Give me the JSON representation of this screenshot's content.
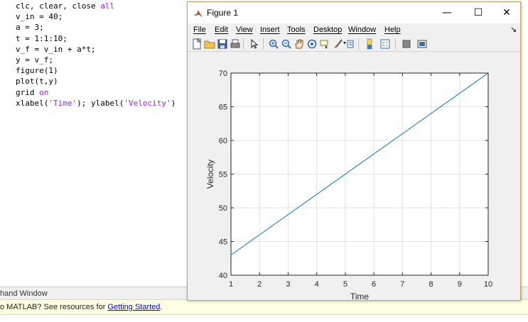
{
  "editor": {
    "lines": [
      {
        "parts": [
          {
            "t": "clc, clear, close ",
            "c": "plain"
          },
          {
            "t": "all",
            "c": "kw"
          }
        ]
      },
      {
        "parts": [
          {
            "t": "v_in = 40;",
            "c": "plain"
          }
        ]
      },
      {
        "parts": [
          {
            "t": "a = 3;",
            "c": "plain"
          }
        ]
      },
      {
        "parts": [
          {
            "t": "t = 1:1:10;",
            "c": "plain"
          }
        ]
      },
      {
        "parts": [
          {
            "t": "v_f = v_in + a*t;",
            "c": "plain"
          }
        ]
      },
      {
        "parts": [
          {
            "t": "y = v_f;",
            "c": "plain"
          }
        ]
      },
      {
        "parts": [
          {
            "t": "figure(1)",
            "c": "plain"
          }
        ]
      },
      {
        "parts": [
          {
            "t": "plot(t,y)",
            "c": "plain"
          }
        ]
      },
      {
        "parts": [
          {
            "t": "grid ",
            "c": "plain"
          },
          {
            "t": "on",
            "c": "kw"
          }
        ]
      },
      {
        "parts": [
          {
            "t": "xlabel(",
            "c": "plain"
          },
          {
            "t": "'Time'",
            "c": "str"
          },
          {
            "t": "); ylabel(",
            "c": "plain"
          },
          {
            "t": "'Velocity'",
            "c": "str"
          },
          {
            "t": ")",
            "c": "plain"
          }
        ]
      }
    ]
  },
  "command_window": {
    "title": "hand Window",
    "banner_prefix": "o MATLAB? See resources for ",
    "banner_link": "Getting Started",
    "banner_suffix": "."
  },
  "figure": {
    "title": "Figure 1",
    "buttons": {
      "minimize": "—",
      "maximize": "☐",
      "close": "✕"
    },
    "menu": [
      {
        "label": "File",
        "name": "menu-file"
      },
      {
        "label": "Edit",
        "name": "menu-edit"
      },
      {
        "label": "View",
        "name": "menu-view"
      },
      {
        "label": "Insert",
        "name": "menu-insert"
      },
      {
        "label": "Tools",
        "name": "menu-tools"
      },
      {
        "label": "Desktop",
        "name": "menu-desktop"
      },
      {
        "label": "Window",
        "name": "menu-window"
      },
      {
        "label": "Help",
        "name": "menu-help"
      }
    ],
    "dock_arrow": "↘",
    "toolbar_icons": [
      "new-figure-icon",
      "open-file-icon",
      "save-icon",
      "print-icon",
      "pointer-icon",
      "zoom-in-icon",
      "zoom-out-icon",
      "pan-icon",
      "rotate-3d-icon",
      "data-cursor-icon",
      "brush-icon",
      "link-plot-icon",
      "colorbar-icon",
      "legend-icon",
      "hide-plot-tools-icon",
      "show-plot-tools-icon"
    ]
  },
  "chart_data": {
    "type": "line",
    "title": "",
    "xlabel": "Time",
    "ylabel": "Velocity",
    "xlim": [
      1,
      10
    ],
    "ylim": [
      40,
      70
    ],
    "xticks": [
      1,
      2,
      3,
      4,
      5,
      6,
      7,
      8,
      9,
      10
    ],
    "yticks": [
      40,
      45,
      50,
      55,
      60,
      65,
      70
    ],
    "grid": true,
    "series": [
      {
        "x": [
          1,
          2,
          3,
          4,
          5,
          6,
          7,
          8,
          9,
          10
        ],
        "y": [
          43,
          46,
          49,
          52,
          55,
          58,
          61,
          64,
          67,
          70
        ],
        "color": "#0072bd"
      }
    ]
  },
  "colors": {
    "line": "#0072bd",
    "window_border": "#c2a15a",
    "banner_bg": "#ffffe1",
    "keyword": "#a020f0"
  }
}
